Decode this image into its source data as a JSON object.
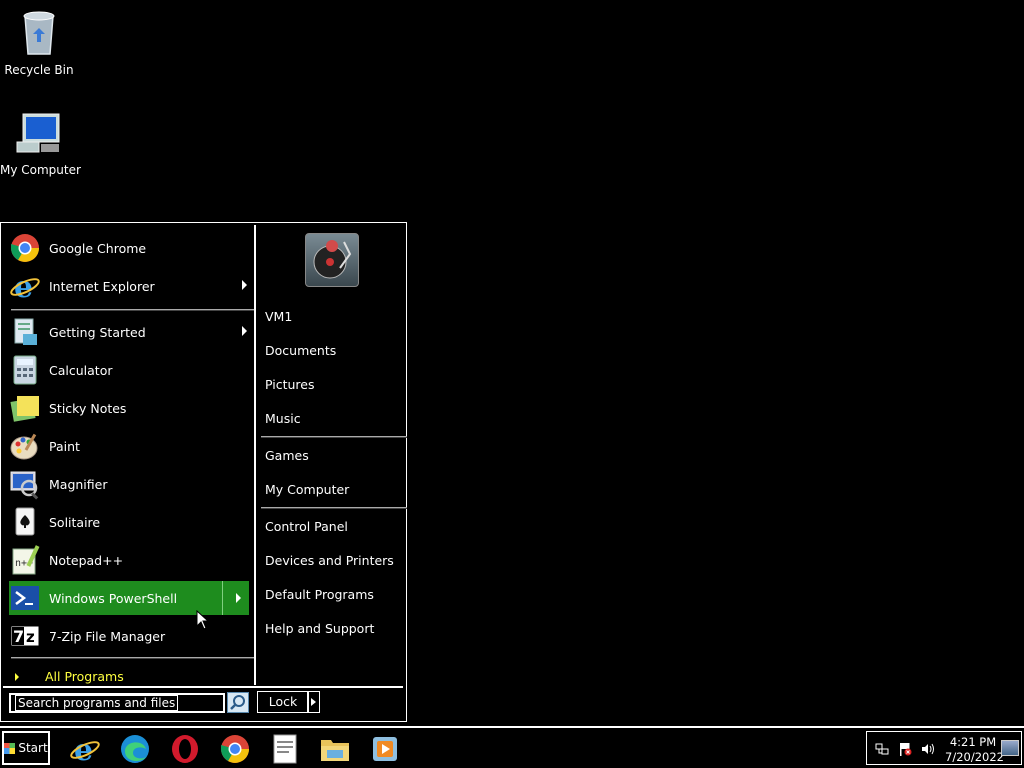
{
  "desktop": {
    "icons": [
      {
        "label": "Recycle Bin",
        "icon": "recycle-bin-icon"
      },
      {
        "label": "My Computer",
        "icon": "computer-icon"
      }
    ]
  },
  "start_menu": {
    "pinned": [
      {
        "label": "Google Chrome",
        "icon": "chrome-icon",
        "submenu": false
      },
      {
        "label": "Internet Explorer",
        "icon": "internet-explorer-icon",
        "submenu": true
      }
    ],
    "recent": [
      {
        "label": "Getting Started",
        "icon": "getting-started-icon",
        "submenu": true
      },
      {
        "label": "Calculator",
        "icon": "calculator-icon",
        "submenu": false
      },
      {
        "label": "Sticky Notes",
        "icon": "sticky-notes-icon",
        "submenu": false
      },
      {
        "label": "Paint",
        "icon": "paint-icon",
        "submenu": false
      },
      {
        "label": "Magnifier",
        "icon": "magnifier-icon",
        "submenu": false
      },
      {
        "label": "Solitaire",
        "icon": "solitaire-icon",
        "submenu": false
      },
      {
        "label": "Notepad++",
        "icon": "notepadpp-icon",
        "submenu": false
      },
      {
        "label": "Windows PowerShell",
        "icon": "powershell-icon",
        "submenu": true,
        "highlighted": true
      },
      {
        "label": "7-Zip File Manager",
        "icon": "7zip-icon",
        "submenu": false
      }
    ],
    "all_programs_label": "All Programs",
    "right_pane": {
      "user_picture": "user-avatar-icon",
      "group1": [
        "VM1",
        "Documents",
        "Pictures",
        "Music"
      ],
      "group2": [
        "Games",
        "My Computer"
      ],
      "group3": [
        "Control Panel",
        "Devices and Printers",
        "Default Programs",
        "Help and Support"
      ]
    },
    "search_placeholder": "Search programs and files",
    "lock_label": "Lock"
  },
  "taskbar": {
    "start_label": "Start",
    "pinned_apps": [
      "internet-explorer-icon",
      "edge-icon",
      "opera-icon",
      "chrome-icon",
      "notepad-icon",
      "file-explorer-icon",
      "media-player-icon"
    ],
    "tray": {
      "icons": [
        "network-icon",
        "action-center-flag-icon",
        "volume-icon"
      ],
      "time": "4:21 PM",
      "date": "7/20/2022"
    }
  }
}
